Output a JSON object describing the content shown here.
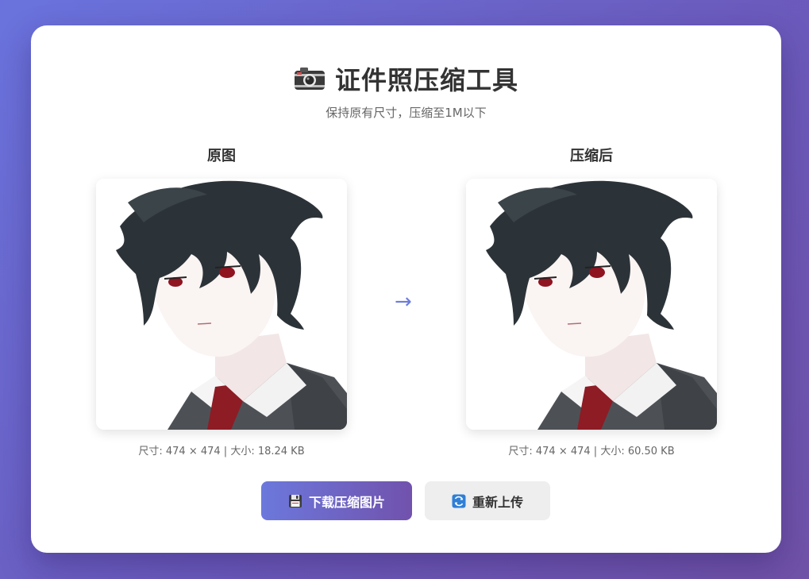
{
  "header": {
    "icon": "camera-icon",
    "title": "证件照压缩工具",
    "subtitle": "保持原有尺寸，压缩至1M以下"
  },
  "original": {
    "label": "原图",
    "info": "尺寸: 474 × 474 | 大小: 18.24 KB"
  },
  "compressed": {
    "label": "压缩后",
    "info": "尺寸: 474 × 474 | 大小: 60.50 KB"
  },
  "arrow": "→",
  "actions": {
    "download_label": "下载压缩图片",
    "download_icon": "floppy-disk-icon",
    "reupload_label": "重新上传",
    "reupload_icon": "refresh-icon"
  },
  "colors": {
    "accent_start": "#6c78dc",
    "accent_end": "#7152ad"
  }
}
